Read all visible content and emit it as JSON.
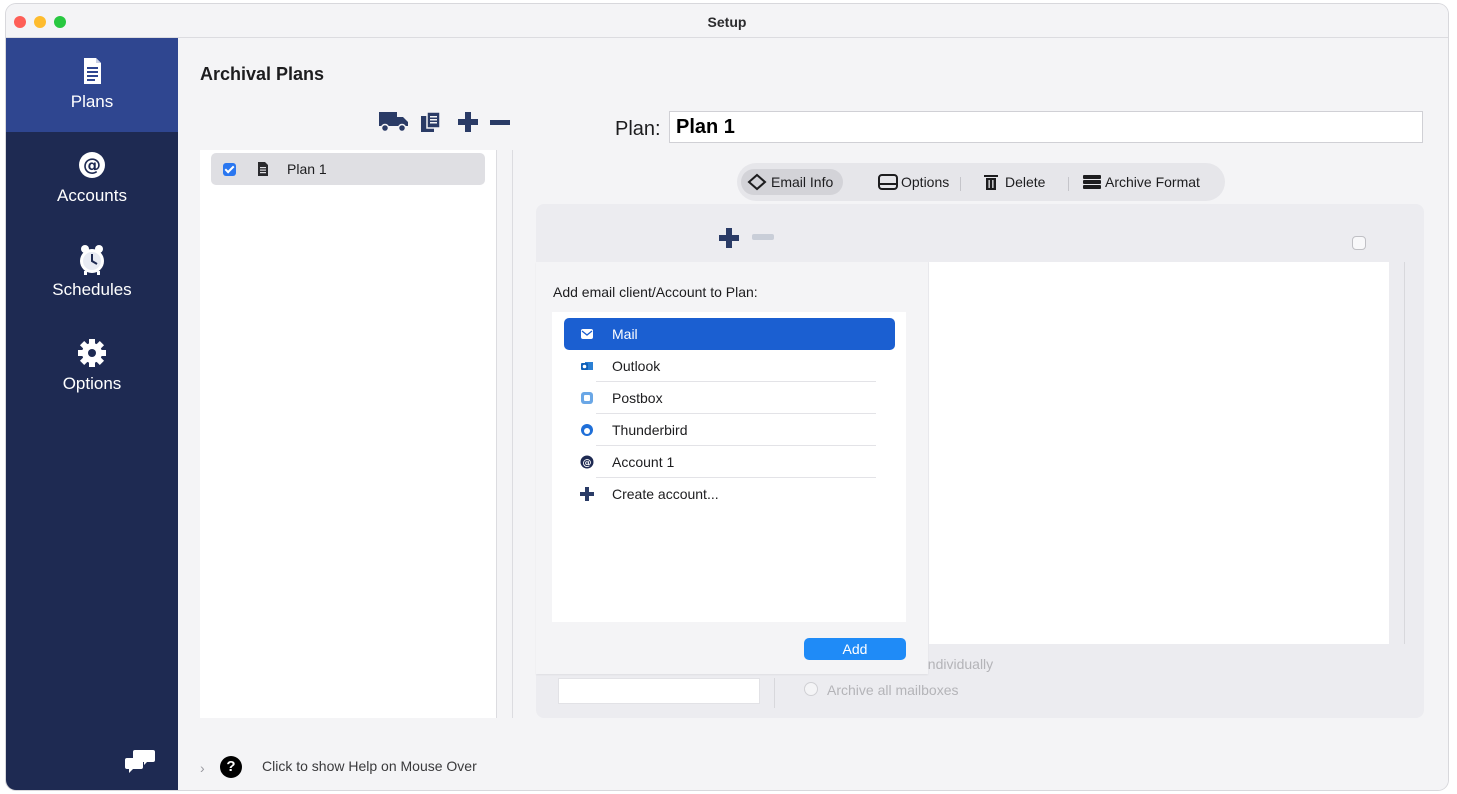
{
  "window": {
    "title": "Setup"
  },
  "sidebar": {
    "items": [
      {
        "label": "Plans",
        "icon": "document-icon",
        "active": true
      },
      {
        "label": "Accounts",
        "icon": "at-sign-icon",
        "active": false
      },
      {
        "label": "Schedules",
        "icon": "alarm-clock-icon",
        "active": false
      },
      {
        "label": "Options",
        "icon": "gear-icon",
        "active": false
      }
    ],
    "footer_icon": "chat-bubbles-icon"
  },
  "main": {
    "title": "Archival Plans",
    "plan_toolbar_icons": [
      "truck-icon",
      "copy-icon",
      "plus-icon",
      "minus-icon"
    ],
    "plans": [
      {
        "label": "Plan 1",
        "checked": true,
        "icon": "document-icon"
      }
    ],
    "plan_name": {
      "label": "Plan:",
      "value": "Plan 1"
    },
    "tabs": [
      {
        "label": "Email Info",
        "icon": "diamond-icon",
        "active": true
      },
      {
        "label": "Options",
        "icon": "drive-icon",
        "active": false
      },
      {
        "label": "Delete",
        "icon": "trash-icon",
        "active": false
      },
      {
        "label": "Archive Format",
        "icon": "stack-icon",
        "active": false
      }
    ],
    "background_options": {
      "individually_partial": "es individually",
      "archive_all": "Archive all mailboxes"
    }
  },
  "popover": {
    "title": "Add email client/Account to Plan:",
    "items": [
      {
        "label": "Mail",
        "icon": "mail-icon",
        "selected": true
      },
      {
        "label": "Outlook",
        "icon": "outlook-icon",
        "selected": false
      },
      {
        "label": "Postbox",
        "icon": "postbox-icon",
        "selected": false
      },
      {
        "label": "Thunderbird",
        "icon": "thunderbird-icon",
        "selected": false
      },
      {
        "label": "Account 1",
        "icon": "at-sign-icon",
        "selected": false
      },
      {
        "label": "Create account...",
        "icon": "plus-icon",
        "selected": false
      }
    ],
    "add_button": "Add"
  },
  "help": {
    "text": "Click to show Help on Mouse Over",
    "icon": "question-icon",
    "icon_glyph": "?"
  },
  "colors": {
    "sidebar_bg": "#1e2a52",
    "sidebar_active": "#2f4690",
    "accent": "#1b5fd1",
    "button": "#1f8bf7"
  }
}
